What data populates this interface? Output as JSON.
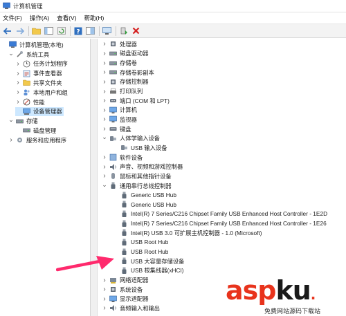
{
  "window": {
    "title": "计算机管理"
  },
  "menu": [
    "文件(F)",
    "操作(A)",
    "查看(V)",
    "帮助(H)"
  ],
  "left_tree": [
    {
      "label": "计算机管理(本地)",
      "indent": 0,
      "expander": "",
      "icon": "computer-management-icon",
      "selected": false
    },
    {
      "label": "系统工具",
      "indent": 1,
      "expander": "v",
      "icon": "tools-icon",
      "selected": false
    },
    {
      "label": "任务计划程序",
      "indent": 2,
      "expander": ">",
      "icon": "clock-icon",
      "selected": false
    },
    {
      "label": "事件查看器",
      "indent": 2,
      "expander": ">",
      "icon": "event-viewer-icon",
      "selected": false
    },
    {
      "label": "共享文件夹",
      "indent": 2,
      "expander": ">",
      "icon": "shared-folder-icon",
      "selected": false
    },
    {
      "label": "本地用户和组",
      "indent": 2,
      "expander": ">",
      "icon": "users-icon",
      "selected": false
    },
    {
      "label": "性能",
      "indent": 2,
      "expander": ">",
      "icon": "performance-icon",
      "selected": false
    },
    {
      "label": "设备管理器",
      "indent": 2,
      "expander": "",
      "icon": "device-manager-icon",
      "selected": true
    },
    {
      "label": "存储",
      "indent": 1,
      "expander": "v",
      "icon": "storage-icon",
      "selected": false
    },
    {
      "label": "磁盘管理",
      "indent": 2,
      "expander": "",
      "icon": "disk-icon",
      "selected": false
    },
    {
      "label": "服务和应用程序",
      "indent": 1,
      "expander": ">",
      "icon": "services-icon",
      "selected": false
    }
  ],
  "device_tree": [
    {
      "label": "处理器",
      "indent": 0,
      "expander": ">",
      "icon": "cpu-icon"
    },
    {
      "label": "磁盘驱动器",
      "indent": 0,
      "expander": ">",
      "icon": "disk-drive-icon"
    },
    {
      "label": "存储卷",
      "indent": 0,
      "expander": ">",
      "icon": "volume-icon"
    },
    {
      "label": "存储卷影副本",
      "indent": 0,
      "expander": ">",
      "icon": "volume-icon"
    },
    {
      "label": "存储控制器",
      "indent": 0,
      "expander": ">",
      "icon": "storage-controller-icon"
    },
    {
      "label": "打印队列",
      "indent": 0,
      "expander": ">",
      "icon": "printer-icon"
    },
    {
      "label": "端口 (COM 和 LPT)",
      "indent": 0,
      "expander": ">",
      "icon": "port-icon"
    },
    {
      "label": "计算机",
      "indent": 0,
      "expander": ">",
      "icon": "monitor-icon"
    },
    {
      "label": "监视器",
      "indent": 0,
      "expander": ">",
      "icon": "monitor-icon"
    },
    {
      "label": "键盘",
      "indent": 0,
      "expander": ">",
      "icon": "keyboard-icon"
    },
    {
      "label": "人体学输入设备",
      "indent": 0,
      "expander": "v",
      "icon": "hid-icon"
    },
    {
      "label": "USB 输入设备",
      "indent": 1,
      "expander": "",
      "icon": "hid-icon"
    },
    {
      "label": "软件设备",
      "indent": 0,
      "expander": ">",
      "icon": "software-device-icon"
    },
    {
      "label": "声音、视频和游戏控制器",
      "indent": 0,
      "expander": ">",
      "icon": "speaker-icon"
    },
    {
      "label": "鼠标和其他指针设备",
      "indent": 0,
      "expander": ">",
      "icon": "mouse-icon"
    },
    {
      "label": "通用串行总线控制器",
      "indent": 0,
      "expander": "v",
      "icon": "usb-icon"
    },
    {
      "label": "Generic USB Hub",
      "indent": 1,
      "expander": "",
      "icon": "usb-icon"
    },
    {
      "label": "Generic USB Hub",
      "indent": 1,
      "expander": "",
      "icon": "usb-icon"
    },
    {
      "label": "Intel(R) 7 Series/C216 Chipset Family USB Enhanced Host Controller - 1E2D",
      "indent": 1,
      "expander": "",
      "icon": "usb-icon"
    },
    {
      "label": "Intel(R) 7 Series/C216 Chipset Family USB Enhanced Host Controller - 1E26",
      "indent": 1,
      "expander": "",
      "icon": "usb-icon"
    },
    {
      "label": "Intel(R) USB 3.0 可扩展主机控制器 - 1.0 (Microsoft)",
      "indent": 1,
      "expander": "",
      "icon": "usb-icon"
    },
    {
      "label": "USB Root Hub",
      "indent": 1,
      "expander": "",
      "icon": "usb-icon"
    },
    {
      "label": "USB Root Hub",
      "indent": 1,
      "expander": "",
      "icon": "usb-icon"
    },
    {
      "label": "USB 大容量存储设备",
      "indent": 1,
      "expander": "",
      "icon": "usb-icon"
    },
    {
      "label": "USB 根集线器(xHCI)",
      "indent": 1,
      "expander": "",
      "icon": "usb-icon"
    },
    {
      "label": "网络适配器",
      "indent": 0,
      "expander": ">",
      "icon": "network-adapter-icon"
    },
    {
      "label": "系统设备",
      "indent": 0,
      "expander": ">",
      "icon": "system-device-icon"
    },
    {
      "label": "显示适配器",
      "indent": 0,
      "expander": ">",
      "icon": "display-adapter-icon"
    },
    {
      "label": "音频输入和输出",
      "indent": 0,
      "expander": ">",
      "icon": "speaker-icon"
    }
  ],
  "watermark": {
    "brand_a": "asp",
    "brand_b": "ku",
    "brand_dot": ".",
    "sub": "免费网站源码下载站"
  },
  "colors": {
    "selected": "#cde8ff",
    "arrow": "#ff2a6d",
    "brand_red": "#e8331c"
  }
}
